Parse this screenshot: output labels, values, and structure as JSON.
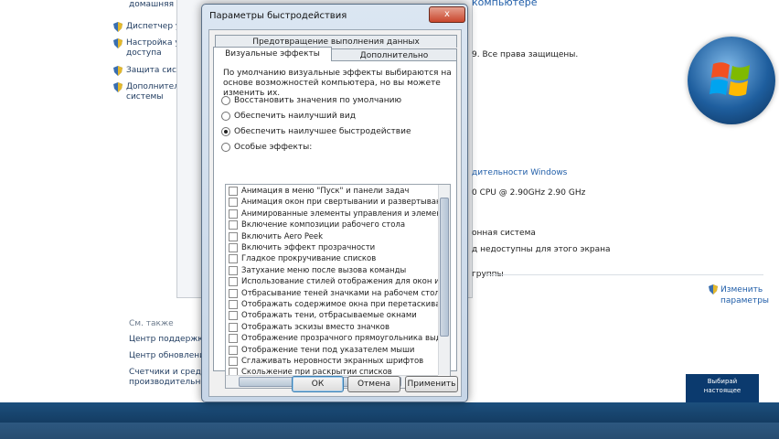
{
  "sidebar": {
    "top_text": "домашняя сети",
    "items": [
      {
        "label": "Диспетчер у"
      },
      {
        "label": "Настройка у\nдоступа"
      },
      {
        "label": "Защита систе"
      },
      {
        "label": "Дополнител\nсистемы"
      }
    ],
    "see_also": "См. также",
    "links": [
      {
        "label": "Центр поддержки"
      },
      {
        "label": "Центр обновления"
      },
      {
        "label": "Счетчики и средст\nпроизводительнос"
      }
    ]
  },
  "system_info": {
    "top_link": "компьютере",
    "copyright": "9. Все права защищены.",
    "perf_link": "дительности Windows",
    "cpu": "0 CPU @ 2.90GHz   2.90 GHz",
    "os_type": "онная система",
    "pen_touch": "д недоступны для этого экрана",
    "workgroup": "группы",
    "change_link": "Изменить\nпараметры",
    "badge_text": "Выбирай\nнастоящее"
  },
  "dialog": {
    "title": "Параметры быстродействия",
    "close_label": "x",
    "tabs": {
      "dep": "Предотвращение выполнения данных",
      "visual": "Визуальные эффекты",
      "advanced": "Дополнительно"
    },
    "description": "По умолчанию визуальные эффекты выбираются на основе возможностей компьютера, но вы можете изменить их.",
    "radios": [
      {
        "label": "Восстановить значения по умолчанию",
        "selected": false
      },
      {
        "label": "Обеспечить наилучший вид",
        "selected": false
      },
      {
        "label": "Обеспечить наилучшее быстродействие",
        "selected": true
      },
      {
        "label": "Особые эффекты:",
        "selected": false
      }
    ],
    "effects": [
      "Анимация в меню \"Пуск\" и панели задач",
      "Анимация окон при свертывании и развертывании",
      "Анимированные элементы управления и элементы вну",
      "Включение композиции рабочего стола",
      "Включить Aero Peek",
      "Включить эффект прозрачности",
      "Гладкое прокручивание списков",
      "Затухание меню после вызова команды",
      "Использование стилей отображения для окон и кнопо",
      "Отбрасывание теней значками на рабочем столе",
      "Отображать содержимое окна при перетаскивании",
      "Отображать тени, отбрасываемые окнами",
      "Отображать эскизы вместо значков",
      "Отображение прозрачного прямоугольника выделени",
      "Отображение тени под указателем мыши",
      "Сглаживать неровности экранных шрифтов",
      "Скольжение при раскрытии списков"
    ],
    "buttons": {
      "ok": "ОК",
      "cancel": "Отмена",
      "apply": "Применить"
    }
  },
  "colors": {
    "link": "#1f5da8",
    "taskbar": "#1c4f7d",
    "close": "#c9462c"
  }
}
